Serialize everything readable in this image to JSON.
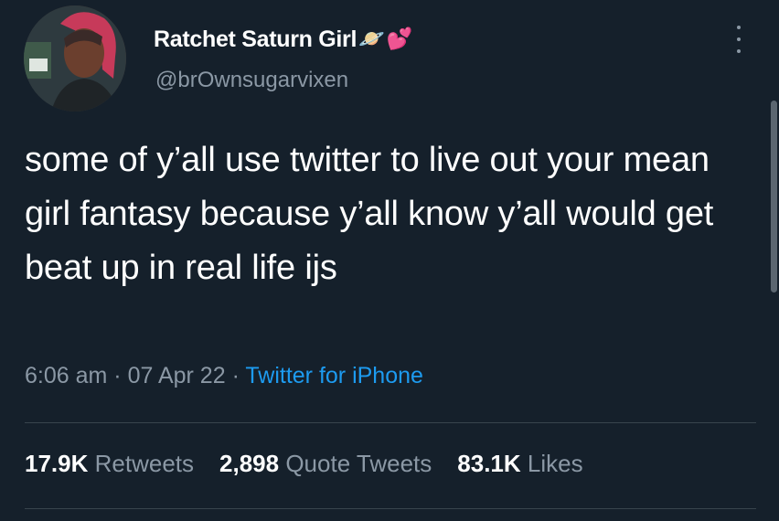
{
  "user": {
    "display_name": "Ratchet Saturn Girl",
    "name_emoji_1": "🪐",
    "name_emoji_2": "💕",
    "handle": "@brOwnsugarvixen"
  },
  "tweet": {
    "text": "some of y’all use twitter to live out your mean girl fantasy because y’all know y’all would get beat up in real life ijs",
    "time": "6:06 am",
    "sep1": "·",
    "date": "07 Apr 22",
    "sep2": "·",
    "source": "Twitter for iPhone"
  },
  "stats": {
    "retweets_count": "17.9K",
    "retweets_label": "Retweets",
    "quotes_count": "2,898",
    "quotes_label": "Quote Tweets",
    "likes_count": "83.1K",
    "likes_label": "Likes"
  },
  "icons": {
    "more": "more-options-icon",
    "avatar": "profile-avatar"
  },
  "colors": {
    "background": "#15202b",
    "text": "#ffffff",
    "secondary": "#8b98a5",
    "link": "#1d9bf0",
    "divider": "#38444d"
  }
}
